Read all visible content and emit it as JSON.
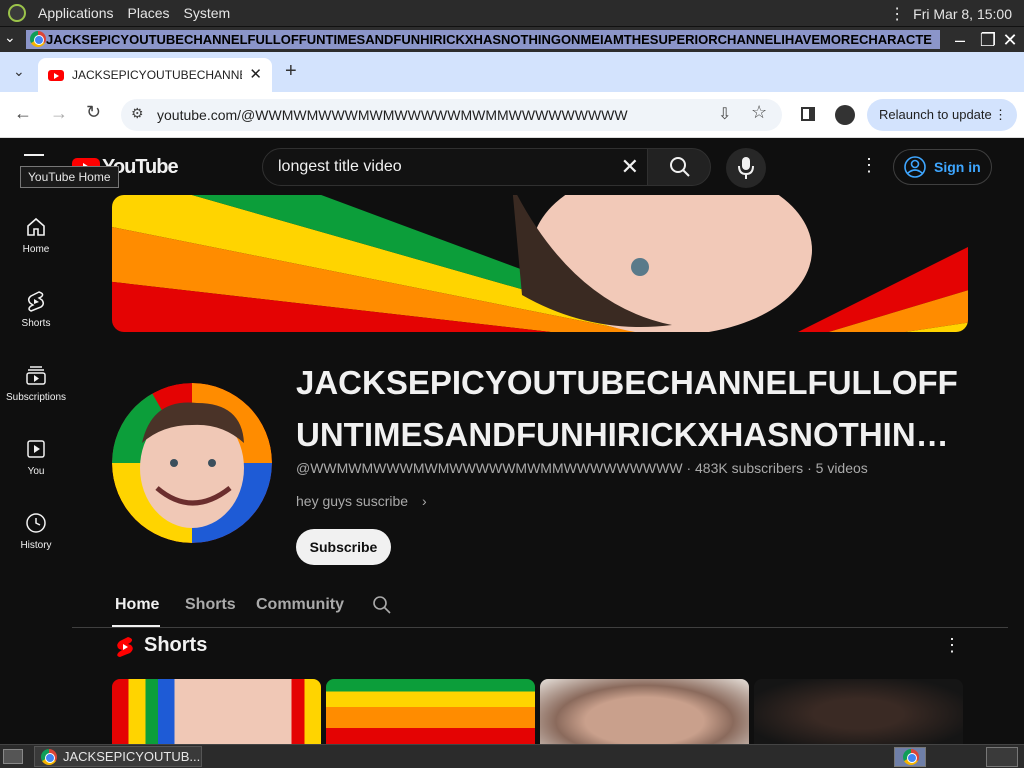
{
  "panel": {
    "applications": "Applications",
    "places": "Places",
    "system": "System",
    "clock": "Fri Mar  8, 15:00"
  },
  "window": {
    "title": "JACKSEPICYOUTUBECHANNELFULLOFFUNTIMESANDFUNHIRICKXHASNOTHINGONMEIAMTHESUPERIORCHANNELIHAVEMORECHARACTE"
  },
  "browser": {
    "tab_title": "JACKSEPICYOUTUBECHANNELFULLOFFUNTIMESANDFUNHIRICKX",
    "url": "youtube.com/@WWMWMWWWMWMWWWWWMWMMWWWWWWWWW",
    "relaunch_label": "Relaunch to update"
  },
  "youtube": {
    "logo_text": "YouTube",
    "tooltip": "YouTube Home",
    "search_value": "longest title video",
    "signin_label": "Sign in",
    "nav": [
      {
        "label": "Home"
      },
      {
        "label": "Shorts"
      },
      {
        "label": "Subscriptions"
      },
      {
        "label": "You"
      },
      {
        "label": "History"
      }
    ],
    "channel": {
      "title": "JACKSEPICYOUTUBECHANNELFULLOFFUNTIMESANDFUNHIRICKXHASNOTHIN…",
      "handle": "@WWMWMWWWMWMWWWWWMWMMWWWWWWWWW",
      "subscribers": "483K subscribers",
      "videos": "5 videos",
      "description": "hey guys suscribe",
      "subscribe_label": "Subscribe"
    },
    "tabs": [
      {
        "label": "Home"
      },
      {
        "label": "Shorts"
      },
      {
        "label": "Community"
      }
    ],
    "shorts_heading": "Shorts"
  },
  "taskbar": {
    "item_label": "JACKSEPICYOUTUB..."
  },
  "colors": {
    "yt_red": "#ff0000",
    "link_blue": "#3ea6ff",
    "bg": "#0f0f0f"
  }
}
